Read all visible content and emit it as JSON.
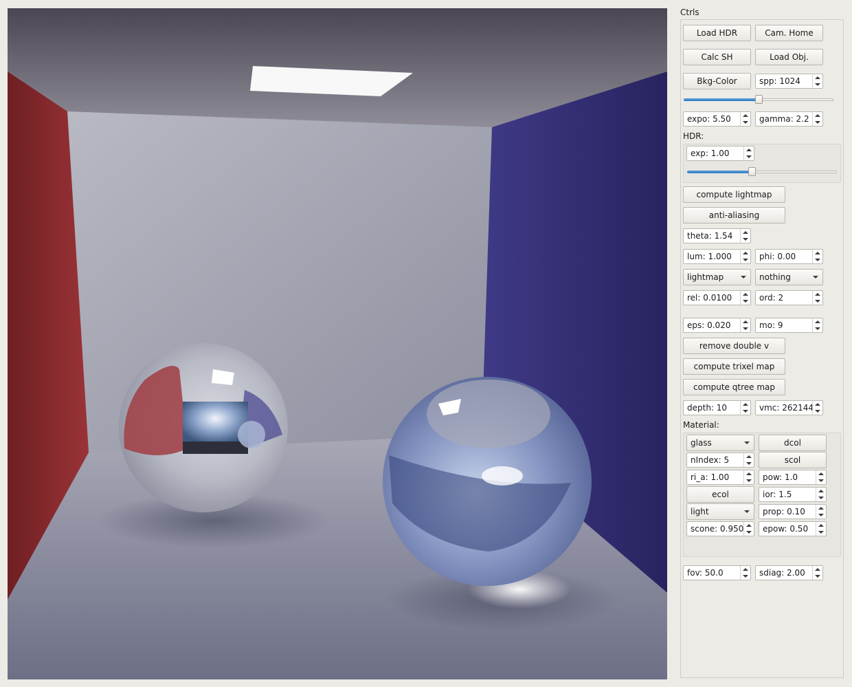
{
  "viewport": {
    "description_icon": "render-scene-icon"
  },
  "panel": {
    "title": "Ctrls",
    "buttons": {
      "load_hdr": "Load HDR",
      "cam_home": "Cam. Home",
      "calc_sh": "Calc SH",
      "load_obj": "Load Obj.",
      "bkg_color": "Bkg-Color",
      "compute_lightmap": "compute lightmap",
      "anti_aliasing": "anti-aliasing",
      "remove_double_v": "remove double v",
      "compute_trixel_map": "compute trixel map",
      "compute_qtree_map": "compute qtree map"
    },
    "spp": "spp: 1024",
    "spp_slider": {
      "value": 0.5
    },
    "expo": "expo: 5.50",
    "gamma": "gamma: 2.2",
    "hdr_label": "HDR:",
    "hdr_exp": "exp: 1.00",
    "hdr_slider": {
      "value": 0.43
    },
    "theta": "theta: 1.54",
    "lum": "lum: 1.000",
    "phi": "phi: 0.00",
    "mode_select": "lightmap",
    "mode_select2": "nothing",
    "rel": "rel: 0.0100",
    "ord": "ord: 2",
    "eps": "eps: 0.020",
    "mo": "mo: 9",
    "depth": "depth: 10",
    "vmc": "vmc: 262144",
    "material_label": "Material:",
    "material": {
      "type_select": "glass",
      "dcol": "dcol",
      "nindex": "nIndex: 5",
      "scol": "scol",
      "ri_a": "ri_a: 1.00",
      "pow": "pow: 1.0",
      "ecol": "ecol",
      "ior": "ior: 1.5",
      "light_select": "light",
      "prop": "prop: 0.10",
      "scone": "scone: 0.950",
      "epow": "epow: 0.50"
    },
    "fov": "fov: 50.0",
    "sdiag": "sdiag: 2.00"
  },
  "colors": {
    "slider_fill": "#3a86cc",
    "left_wall": "#8a2a2c",
    "right_wall": "#363277"
  }
}
